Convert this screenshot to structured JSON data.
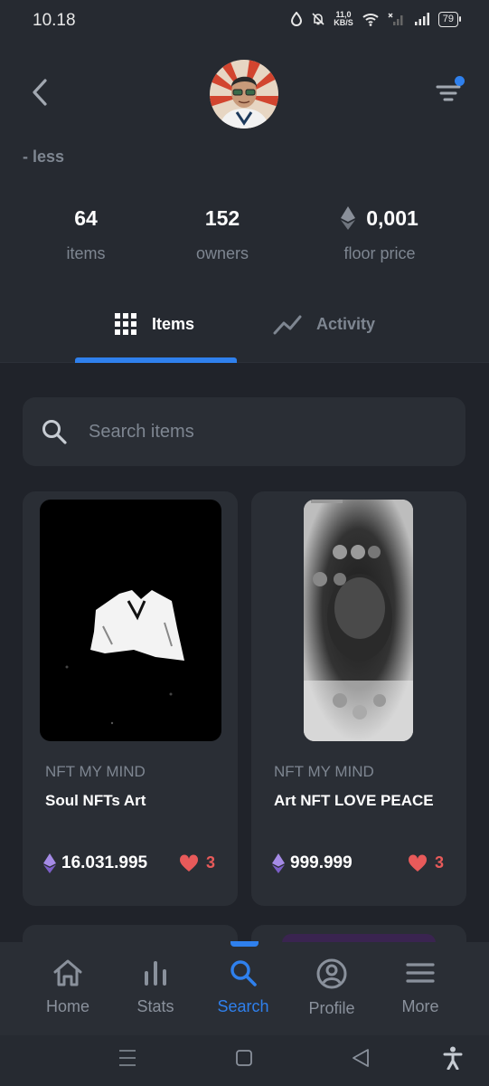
{
  "status_bar": {
    "time": "10.18",
    "net_speed_value": "11,0",
    "net_speed_unit": "KB/S",
    "battery": "79"
  },
  "header": {
    "back_icon": "chevron-left-icon",
    "filter_icon": "filter-icon",
    "less_link": "- less"
  },
  "stats": [
    {
      "value": "64",
      "label": "items"
    },
    {
      "value": "152",
      "label": "owners"
    },
    {
      "value": "0,001",
      "label": "floor price",
      "icon": "ethereum-icon"
    }
  ],
  "tabs": [
    {
      "label": "Items",
      "icon": "grid-icon",
      "active": true
    },
    {
      "label": "Activity",
      "icon": "trend-line-icon",
      "active": false
    }
  ],
  "search": {
    "placeholder": "Search items"
  },
  "items": [
    {
      "collection": "NFT MY MIND",
      "title": "Soul NFTs Art",
      "price": "16.031.995",
      "likes": "3"
    },
    {
      "collection": "NFT MY MIND",
      "title": "Art NFT LOVE PEACE",
      "price": "999.999",
      "likes": "3"
    }
  ],
  "bottom_nav": [
    {
      "label": "Home",
      "icon": "home-icon"
    },
    {
      "label": "Stats",
      "icon": "bar-chart-icon"
    },
    {
      "label": "Search",
      "icon": "search-icon",
      "active": true
    },
    {
      "label": "Profile",
      "icon": "user-circle-icon"
    },
    {
      "label": "More",
      "icon": "menu-icon"
    }
  ],
  "colors": {
    "background": "#262a31",
    "card": "#2a2e35",
    "accent": "#2f80ed",
    "muted_text": "#7e8691",
    "like": "#e85a5a",
    "eth": "#8c6bd8"
  }
}
